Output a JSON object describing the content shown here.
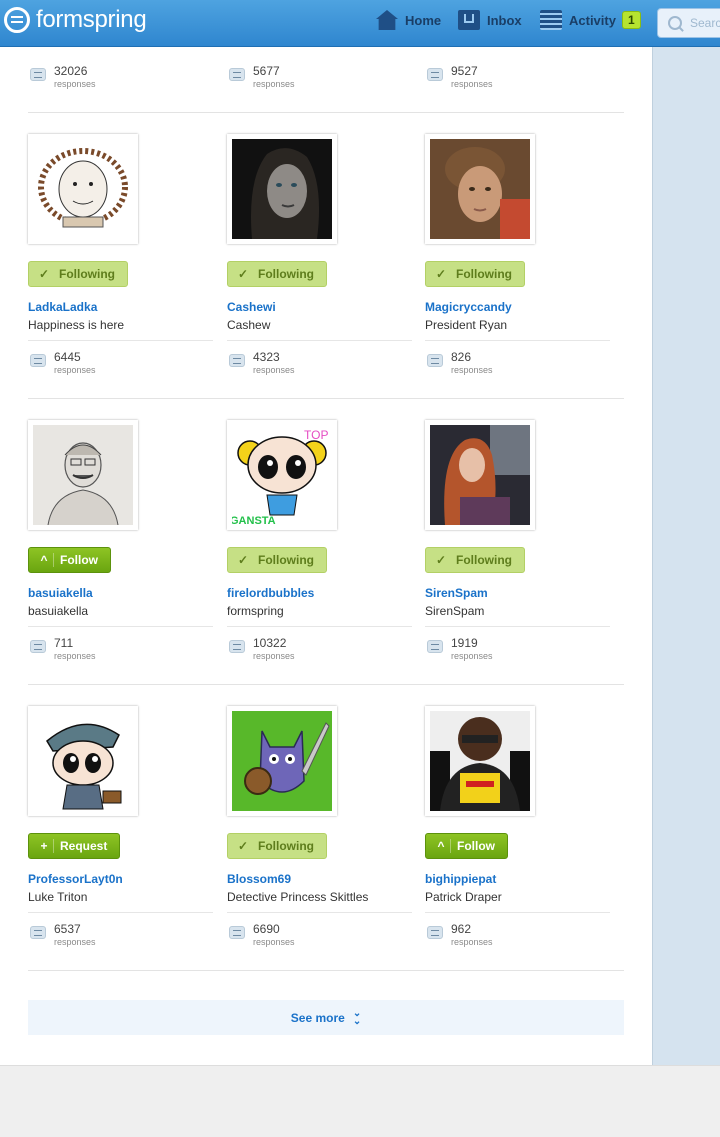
{
  "header": {
    "logo_text": "formspring",
    "nav": [
      {
        "label": "Home",
        "icon": "home-icon"
      },
      {
        "label": "Inbox",
        "icon": "inbox-icon"
      },
      {
        "label": "Activity",
        "icon": "activity-icon",
        "badge": "1"
      }
    ],
    "search_placeholder": "Search"
  },
  "top_row": [
    {
      "count": "32026",
      "label": "responses"
    },
    {
      "count": "5677",
      "label": "responses"
    },
    {
      "count": "9527",
      "label": "responses"
    }
  ],
  "rows": [
    [
      {
        "button": "Following",
        "button_style": "following",
        "username": "LadkaLadka",
        "name": "Happiness is here",
        "count": "6445",
        "label": "responses"
      },
      {
        "button": "Following",
        "button_style": "following",
        "username": "Cashewi",
        "name": "Cashew",
        "count": "4323",
        "label": "responses"
      },
      {
        "button": "Following",
        "button_style": "following",
        "username": "Magicryccandy",
        "name": "President Ryan",
        "count": "826",
        "label": "responses"
      }
    ],
    [
      {
        "button": "Follow",
        "button_style": "follow",
        "username": "basuiakella",
        "name": "basuiakella",
        "count": "711",
        "label": "responses"
      },
      {
        "button": "Following",
        "button_style": "following",
        "username": "firelordbubbles",
        "name": "formspring",
        "count": "10322",
        "label": "responses"
      },
      {
        "button": "Following",
        "button_style": "following",
        "username": "SirenSpam",
        "name": "SirenSpam",
        "count": "1919",
        "label": "responses"
      }
    ],
    [
      {
        "button": "Request",
        "button_style": "request",
        "username": "ProfessorLayt0n",
        "name": "Luke Triton",
        "count": "6537",
        "label": "responses"
      },
      {
        "button": "Following",
        "button_style": "following",
        "username": "Blossom69",
        "name": "Detective Princess Skittles",
        "count": "6690",
        "label": "responses"
      },
      {
        "button": "Follow",
        "button_style": "follow",
        "username": "bighippiepat",
        "name": "Patrick Draper",
        "count": "962",
        "label": "responses"
      }
    ]
  ],
  "avatar_texts": {
    "firelordbubbles_top": "TOP",
    "firelordbubbles_bottom": "GANSTA"
  },
  "see_more": "See more",
  "colors": {
    "header": "#3a94d9",
    "link": "#1a72c9",
    "follow_green": "#7cb51a",
    "following_green": "#c6e085"
  }
}
